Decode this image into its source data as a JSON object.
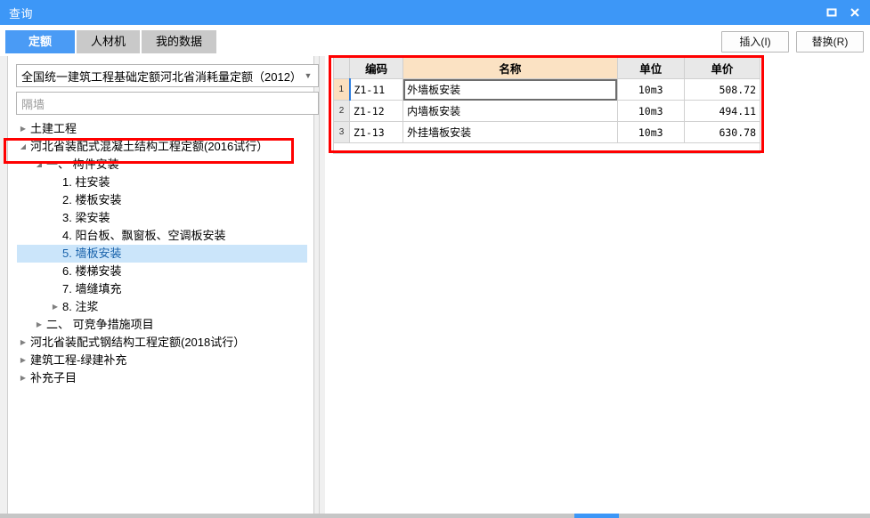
{
  "window": {
    "title": "查询",
    "buttons": [
      {
        "name": "maximize",
        "icon": "maximize-icon"
      },
      {
        "name": "close",
        "icon": "close-icon"
      }
    ]
  },
  "tabs": [
    {
      "label": "定额",
      "active": true
    },
    {
      "label": "人材机",
      "active": false
    },
    {
      "label": "我的数据",
      "active": false
    }
  ],
  "actions": {
    "insert_label": "插入(I)",
    "replace_label": "替换(R)"
  },
  "left_panel": {
    "combo": {
      "value": "全国统一建筑工程基础定额河北省消耗量定额（2012）",
      "arrow": "chevron-down-icon"
    },
    "search": {
      "value": "",
      "placeholder": "隔墙"
    },
    "tree": [
      {
        "label": "土建工程",
        "indent": 0,
        "state": "collapsed",
        "selected": false
      },
      {
        "label": "河北省装配式混凝土结构工程定额(2016试行）",
        "indent": 0,
        "state": "expanded",
        "selected": false
      },
      {
        "label": "一、 构件安装",
        "indent": 1,
        "state": "expanded",
        "selected": false
      },
      {
        "label": "1. 柱安装",
        "indent": 2,
        "state": "leaf",
        "selected": false
      },
      {
        "label": "2. 楼板安装",
        "indent": 2,
        "state": "leaf",
        "selected": false
      },
      {
        "label": "3. 梁安装",
        "indent": 2,
        "state": "leaf",
        "selected": false
      },
      {
        "label": "4. 阳台板、飘窗板、空调板安装",
        "indent": 2,
        "state": "leaf",
        "selected": false
      },
      {
        "label": "5. 墙板安装",
        "indent": 2,
        "state": "leaf",
        "selected": true
      },
      {
        "label": "6. 楼梯安装",
        "indent": 2,
        "state": "leaf",
        "selected": false
      },
      {
        "label": "7. 墙缝填充",
        "indent": 2,
        "state": "leaf",
        "selected": false
      },
      {
        "label": "8. 注浆",
        "indent": 2,
        "state": "collapsed",
        "selected": false
      },
      {
        "label": "二、 可竞争措施项目",
        "indent": 1,
        "state": "collapsed",
        "selected": false
      },
      {
        "label": "河北省装配式钢结构工程定额(2018试行）",
        "indent": 0,
        "state": "collapsed",
        "selected": false
      },
      {
        "label": "建筑工程-绿建补充",
        "indent": 0,
        "state": "collapsed",
        "selected": false
      },
      {
        "label": "补充子目",
        "indent": 0,
        "state": "collapsed",
        "selected": false
      }
    ]
  },
  "grid": {
    "columns": [
      "编码",
      "名称",
      "单位",
      "单价"
    ],
    "rows": [
      {
        "num": "1",
        "code": "Z1-11",
        "name": "外墙板安装",
        "unit": "10m3",
        "price": "508.72",
        "selected": true
      },
      {
        "num": "2",
        "code": "Z1-12",
        "name": "内墙板安装",
        "unit": "10m3",
        "price": "494.11",
        "selected": false
      },
      {
        "num": "3",
        "code": "Z1-13",
        "name": "外挂墙板安装",
        "unit": "10m3",
        "price": "630.78",
        "selected": false
      }
    ]
  },
  "annotations": {
    "color": "#ff0000",
    "boxes": [
      {
        "name": "tree-node-highlight",
        "target": "河北省装配式混凝土结构工程定额(2016试行）"
      },
      {
        "name": "grid-highlight",
        "target": "结果表格"
      }
    ]
  }
}
